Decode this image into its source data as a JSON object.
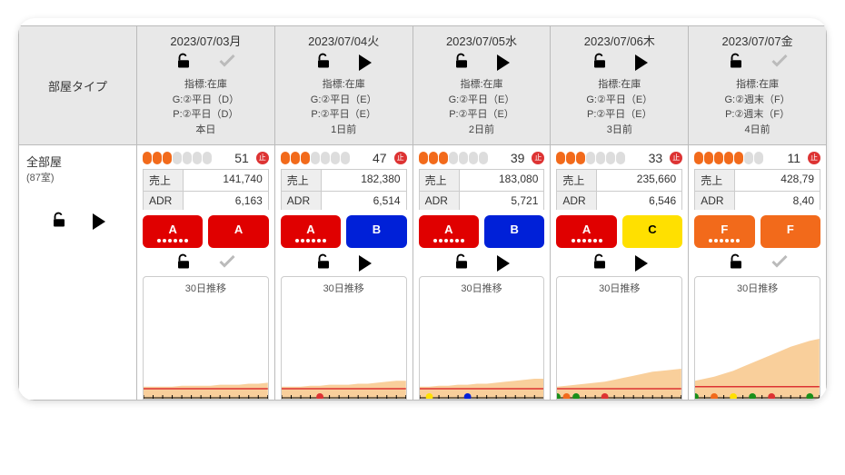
{
  "header_label": "部屋タイプ",
  "columns": [
    {
      "date": "2023/07/03月",
      "icon2": "check",
      "meta1": "指標:在庫",
      "meta2": "G:②平日（D）",
      "meta3": "P:②平日（D）",
      "rel": "本日"
    },
    {
      "date": "2023/07/04火",
      "icon2": "play",
      "meta1": "指標:在庫",
      "meta2": "G:②平日（E）",
      "meta3": "P:②平日（E）",
      "rel": "1日前"
    },
    {
      "date": "2023/07/05水",
      "icon2": "play",
      "meta1": "指標:在庫",
      "meta2": "G:②平日（E）",
      "meta3": "P:②平日（E）",
      "rel": "2日前"
    },
    {
      "date": "2023/07/06木",
      "icon2": "play",
      "meta1": "指標:在庫",
      "meta2": "G:②平日（E）",
      "meta3": "P:②平日（E）",
      "rel": "3日前"
    },
    {
      "date": "2023/07/07金",
      "icon2": "check",
      "meta1": "指標:在庫",
      "meta2": "G:②週末（F）",
      "meta3": "P:②週末（F）",
      "rel": "4日前"
    }
  ],
  "row": {
    "name": "全部屋",
    "count": "(87室)"
  },
  "cells": [
    {
      "pills_on": 3,
      "inv": "51",
      "sales_k": "売上",
      "sales_v": "141,740",
      "adr_k": "ADR",
      "adr_v": "6,163",
      "g1": "A",
      "g1c": "red",
      "g2": "A",
      "g2c": "red",
      "icon2": "check",
      "trend": "30日推移",
      "chart_fill": 0.15
    },
    {
      "pills_on": 3,
      "inv": "47",
      "sales_k": "売上",
      "sales_v": "182,380",
      "adr_k": "ADR",
      "adr_v": "6,514",
      "g1": "A",
      "g1c": "red",
      "g2": "B",
      "g2c": "blue",
      "icon2": "play",
      "trend": "30日推移",
      "chart_fill": 0.18
    },
    {
      "pills_on": 3,
      "inv": "39",
      "sales_k": "売上",
      "sales_v": "183,080",
      "adr_k": "ADR",
      "adr_v": "5,721",
      "g1": "A",
      "g1c": "red",
      "g2": "B",
      "g2c": "blue",
      "icon2": "play",
      "trend": "30日推移",
      "chart_fill": 0.2
    },
    {
      "pills_on": 3,
      "inv": "33",
      "sales_k": "売上",
      "sales_v": "235,660",
      "adr_k": "ADR",
      "adr_v": "6,546",
      "g1": "A",
      "g1c": "red",
      "g2": "C",
      "g2c": "yellow",
      "icon2": "play",
      "trend": "30日推移",
      "chart_fill": 0.3
    },
    {
      "pills_on": 5,
      "inv": "11",
      "sales_k": "売上",
      "sales_v": "428,79",
      "adr_k": "ADR",
      "adr_v": "8,40",
      "g1": "F",
      "g1c": "orange",
      "g2": "F",
      "g2c": "orange",
      "icon2": "check",
      "trend": "30日推移",
      "chart_fill": 0.6
    }
  ],
  "chart_data": [
    {
      "type": "area",
      "title": "30日推移",
      "x_ticks": 14,
      "series": [
        {
          "name": "fill",
          "color": "#f8c78a",
          "values": [
            12,
            12,
            12,
            12,
            13,
            13,
            13,
            13,
            14,
            14,
            14,
            15,
            15,
            16
          ]
        },
        {
          "name": "line",
          "color": "#d33",
          "values": [
            10,
            10,
            10,
            10,
            10,
            10,
            10,
            10,
            10,
            10,
            10,
            10,
            10,
            10
          ]
        }
      ],
      "ylim": [
        0,
        100
      ],
      "markers": []
    },
    {
      "type": "area",
      "title": "30日推移",
      "x_ticks": 14,
      "series": [
        {
          "name": "fill",
          "color": "#f8c78a",
          "values": [
            12,
            12,
            12,
            13,
            13,
            14,
            14,
            14,
            15,
            15,
            16,
            17,
            18,
            18
          ]
        },
        {
          "name": "line",
          "color": "#d33",
          "values": [
            10,
            10,
            10,
            10,
            10,
            10,
            10,
            10,
            10,
            10,
            10,
            10,
            10,
            10
          ]
        }
      ],
      "ylim": [
        0,
        100
      ],
      "markers": [
        {
          "x": 4,
          "color": "#d33"
        }
      ]
    },
    {
      "type": "area",
      "title": "30日推移",
      "x_ticks": 14,
      "series": [
        {
          "name": "fill",
          "color": "#f8c78a",
          "values": [
            12,
            12,
            13,
            13,
            14,
            14,
            15,
            15,
            16,
            17,
            18,
            19,
            20,
            20
          ]
        },
        {
          "name": "line",
          "color": "#d33",
          "values": [
            10,
            10,
            10,
            10,
            10,
            10,
            10,
            10,
            10,
            10,
            10,
            10,
            10,
            10
          ]
        }
      ],
      "ylim": [
        0,
        100
      ],
      "markers": [
        {
          "x": 1,
          "color": "#ffe000"
        },
        {
          "x": 5,
          "color": "#0020d8"
        }
      ]
    },
    {
      "type": "area",
      "title": "30日推移",
      "x_ticks": 14,
      "series": [
        {
          "name": "fill",
          "color": "#f8c78a",
          "values": [
            12,
            13,
            14,
            15,
            16,
            17,
            19,
            21,
            23,
            25,
            27,
            28,
            29,
            30
          ]
        },
        {
          "name": "line",
          "color": "#d33",
          "values": [
            10,
            10,
            10,
            10,
            10,
            10,
            10,
            10,
            10,
            10,
            10,
            10,
            10,
            10
          ]
        }
      ],
      "ylim": [
        0,
        100
      ],
      "markers": [
        {
          "x": 0,
          "color": "#1a8f1a"
        },
        {
          "x": 1,
          "color": "#f26a1b"
        },
        {
          "x": 2,
          "color": "#1a8f1a"
        },
        {
          "x": 5,
          "color": "#d33"
        }
      ]
    },
    {
      "type": "area",
      "title": "30日推移",
      "x_ticks": 14,
      "series": [
        {
          "name": "fill",
          "color": "#f8c78a",
          "values": [
            18,
            20,
            22,
            25,
            28,
            32,
            36,
            40,
            44,
            48,
            52,
            55,
            58,
            60
          ]
        },
        {
          "name": "line",
          "color": "#d33",
          "values": [
            12,
            12,
            12,
            12,
            12,
            12,
            12,
            12,
            12,
            12,
            12,
            12,
            12,
            12
          ]
        }
      ],
      "ylim": [
        0,
        100
      ],
      "markers": [
        {
          "x": 0,
          "color": "#1a8f1a"
        },
        {
          "x": 2,
          "color": "#f26a1b"
        },
        {
          "x": 4,
          "color": "#ffe000"
        },
        {
          "x": 6,
          "color": "#1a8f1a"
        },
        {
          "x": 8,
          "color": "#d33"
        },
        {
          "x": 12,
          "color": "#1a8f1a"
        }
      ]
    }
  ]
}
